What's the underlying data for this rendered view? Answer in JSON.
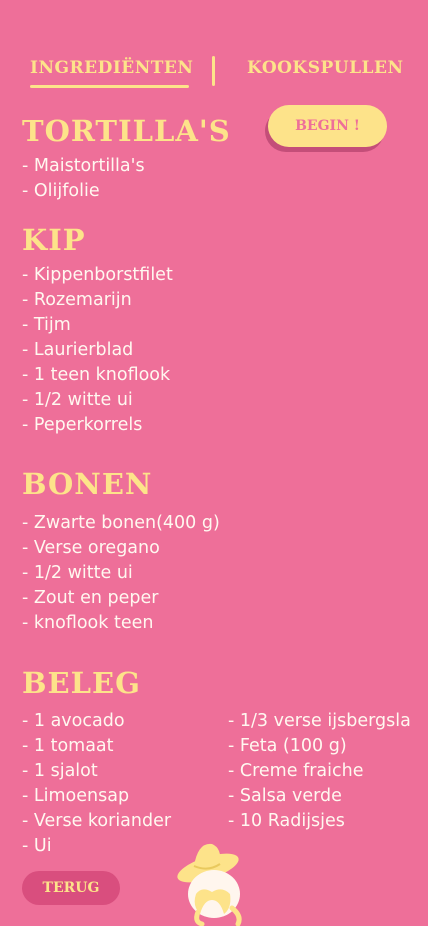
{
  "tabs": {
    "ingredients": "INGREDIËNTEN",
    "separator": "|",
    "tools": "KOOKSPULLEN"
  },
  "begin_button": "BEGIN !",
  "sections": {
    "tortillas": {
      "title": "TORTILLA'S",
      "items": [
        "Maistortilla's",
        "Olijfolie"
      ]
    },
    "kip": {
      "title": "KIP",
      "items": [
        "Kippenborstfilet",
        "Rozemarijn",
        "Tijm",
        "Laurierblad",
        "1 teen knoflook",
        "1/2 witte ui",
        "Peperkorrels"
      ]
    },
    "bonen": {
      "title": "BONEN",
      "items": [
        "Zwarte bonen(400 g)",
        "Verse oregano",
        "1/2 witte ui",
        "Zout en peper",
        "knoflook teen"
      ]
    },
    "beleg": {
      "title": "BELEG",
      "items_left": [
        "1 avocado",
        "1 tomaat",
        "1 sjalot",
        "Limoensap",
        "Verse koriander",
        "Ui"
      ],
      "items_right": [
        "1/3 verse ijsbergsla",
        "Feta (100 g)",
        "Creme fraiche",
        "Salsa verde",
        "10 Radijsjes"
      ]
    }
  },
  "back_button": "TERUG",
  "colors": {
    "background": "#ee6f99",
    "accent": "#fde38a",
    "text": "#fff8f0",
    "button_dark": "#d94e7e"
  },
  "icons": {
    "mascot": "sombrero-mascot-icon"
  }
}
